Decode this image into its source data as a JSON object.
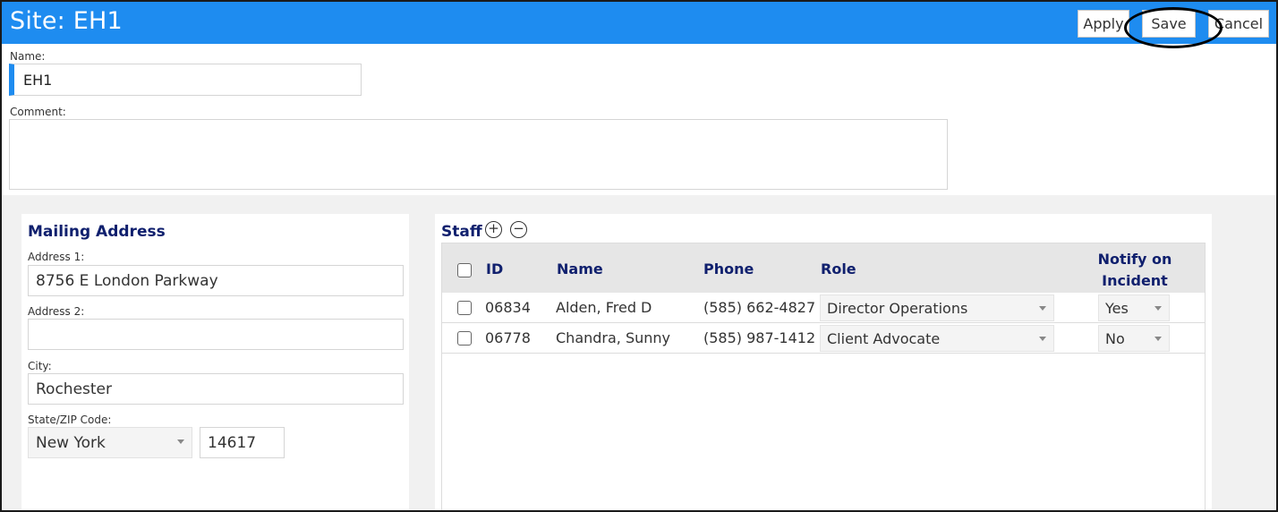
{
  "header": {
    "title": "Site: EH1",
    "apply_label": "Apply",
    "save_label": "Save",
    "cancel_label": "Cancel"
  },
  "form": {
    "name_label": "Name:",
    "name_value": "EH1",
    "comment_label": "Comment:",
    "comment_value": ""
  },
  "mailing": {
    "title": "Mailing Address",
    "address1_label": "Address 1:",
    "address1_value": "8756 E London Parkway",
    "address2_label": "Address 2:",
    "address2_value": "",
    "city_label": "City:",
    "city_value": "Rochester",
    "state_zip_label": "State/ZIP Code:",
    "state_value": "New York",
    "zip_value": "14617"
  },
  "staff": {
    "title": "Staff",
    "add_icon": "plus-circle-icon",
    "remove_icon": "minus-circle-icon",
    "columns": {
      "id": "ID",
      "name": "Name",
      "phone": "Phone",
      "role": "Role",
      "notify_line1": "Notify on",
      "notify_line2": "Incident"
    },
    "rows": [
      {
        "id": "06834",
        "name": "Alden, Fred D",
        "phone": "(585) 662-4827",
        "role": "Director Operations",
        "notify": "Yes"
      },
      {
        "id": "06778",
        "name": "Chandra, Sunny",
        "phone": "(585) 987-1412",
        "role": "Client Advocate",
        "notify": "No"
      }
    ]
  },
  "colors": {
    "header_bg": "#1e8cf0",
    "heading_text": "#10206e",
    "lower_bg": "#f1f1f1"
  }
}
